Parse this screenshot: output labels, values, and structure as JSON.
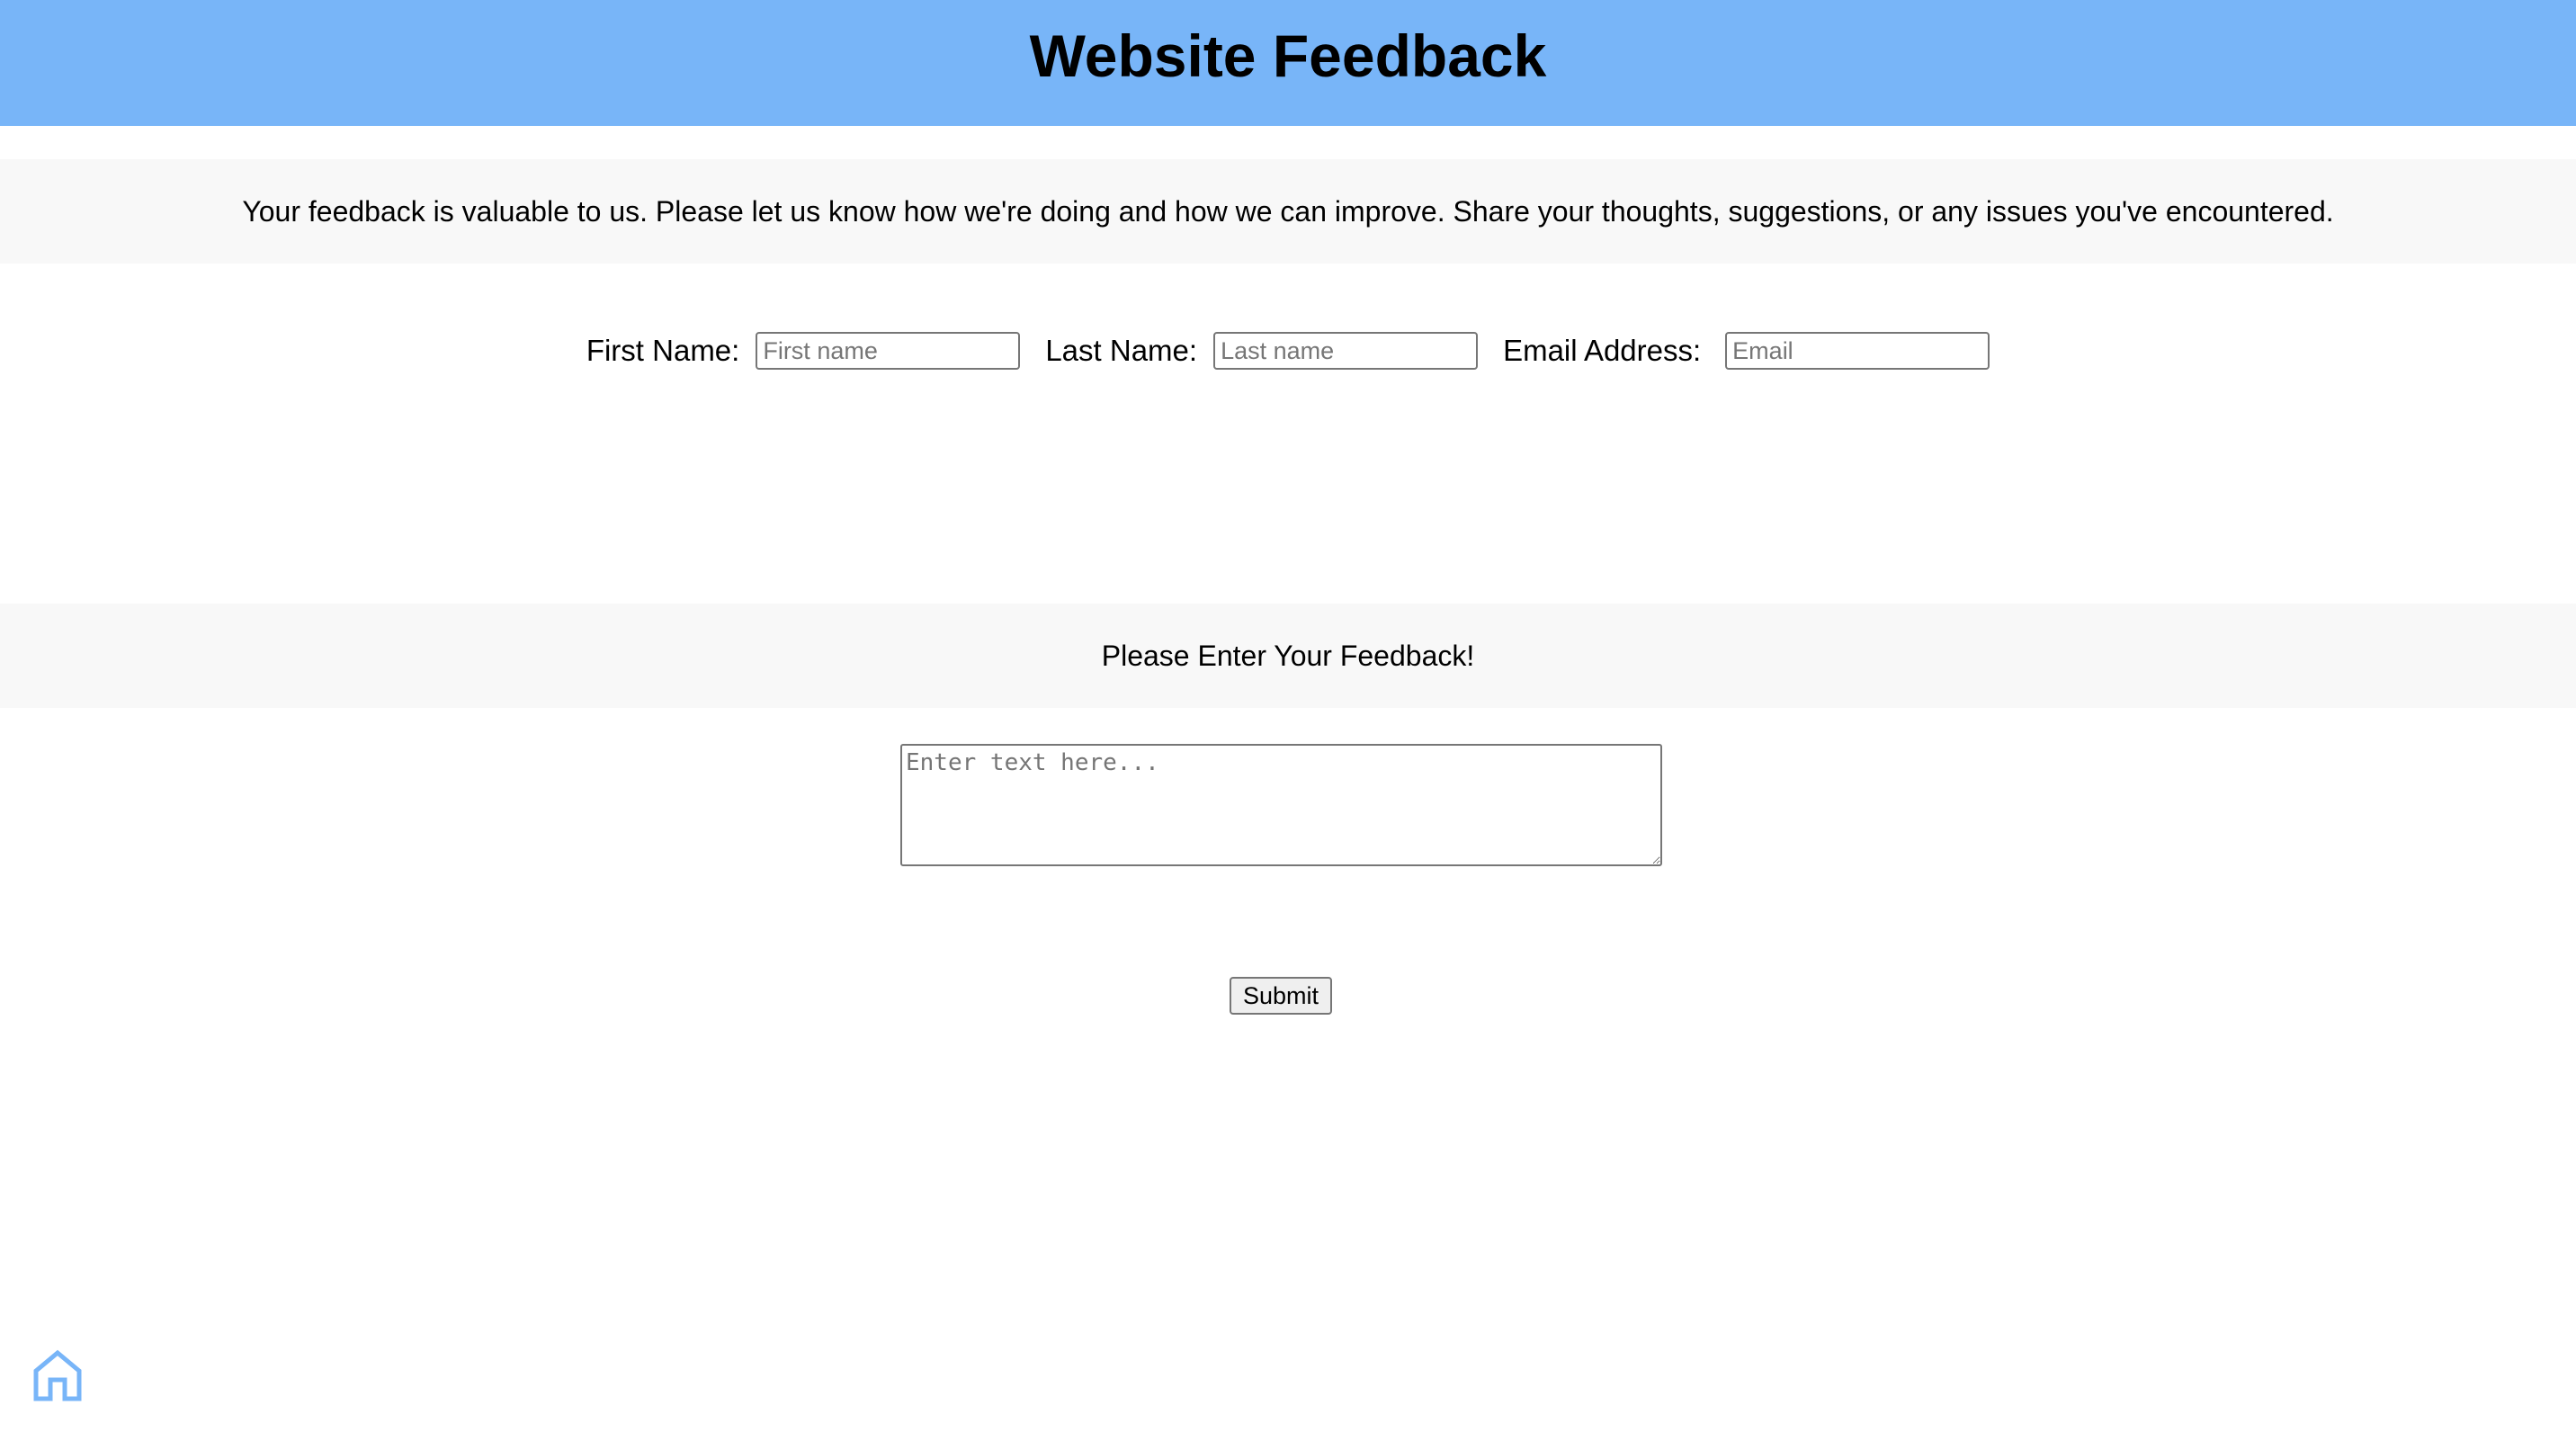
{
  "header": {
    "title": "Website Feedback"
  },
  "intro": {
    "text": "Your feedback is valuable to us. Please let us know how we're doing and how we can improve. Share your thoughts, suggestions, or any issues you've encountered."
  },
  "form": {
    "first_name": {
      "label": "First Name:",
      "placeholder": "First name",
      "value": ""
    },
    "last_name": {
      "label": "Last Name:",
      "placeholder": "Last name",
      "value": ""
    },
    "email": {
      "label": "Email Address:",
      "placeholder": "Email",
      "value": ""
    },
    "feedback_prompt": "Please Enter Your Feedback!",
    "feedback_placeholder": "Enter text here...",
    "submit_label": "Submit"
  },
  "footer": {
    "home_icon": "home-icon"
  },
  "colors": {
    "header_bg": "#78b5f8",
    "band_bg": "#f8f8f8",
    "home_icon": "#78b5f8"
  }
}
